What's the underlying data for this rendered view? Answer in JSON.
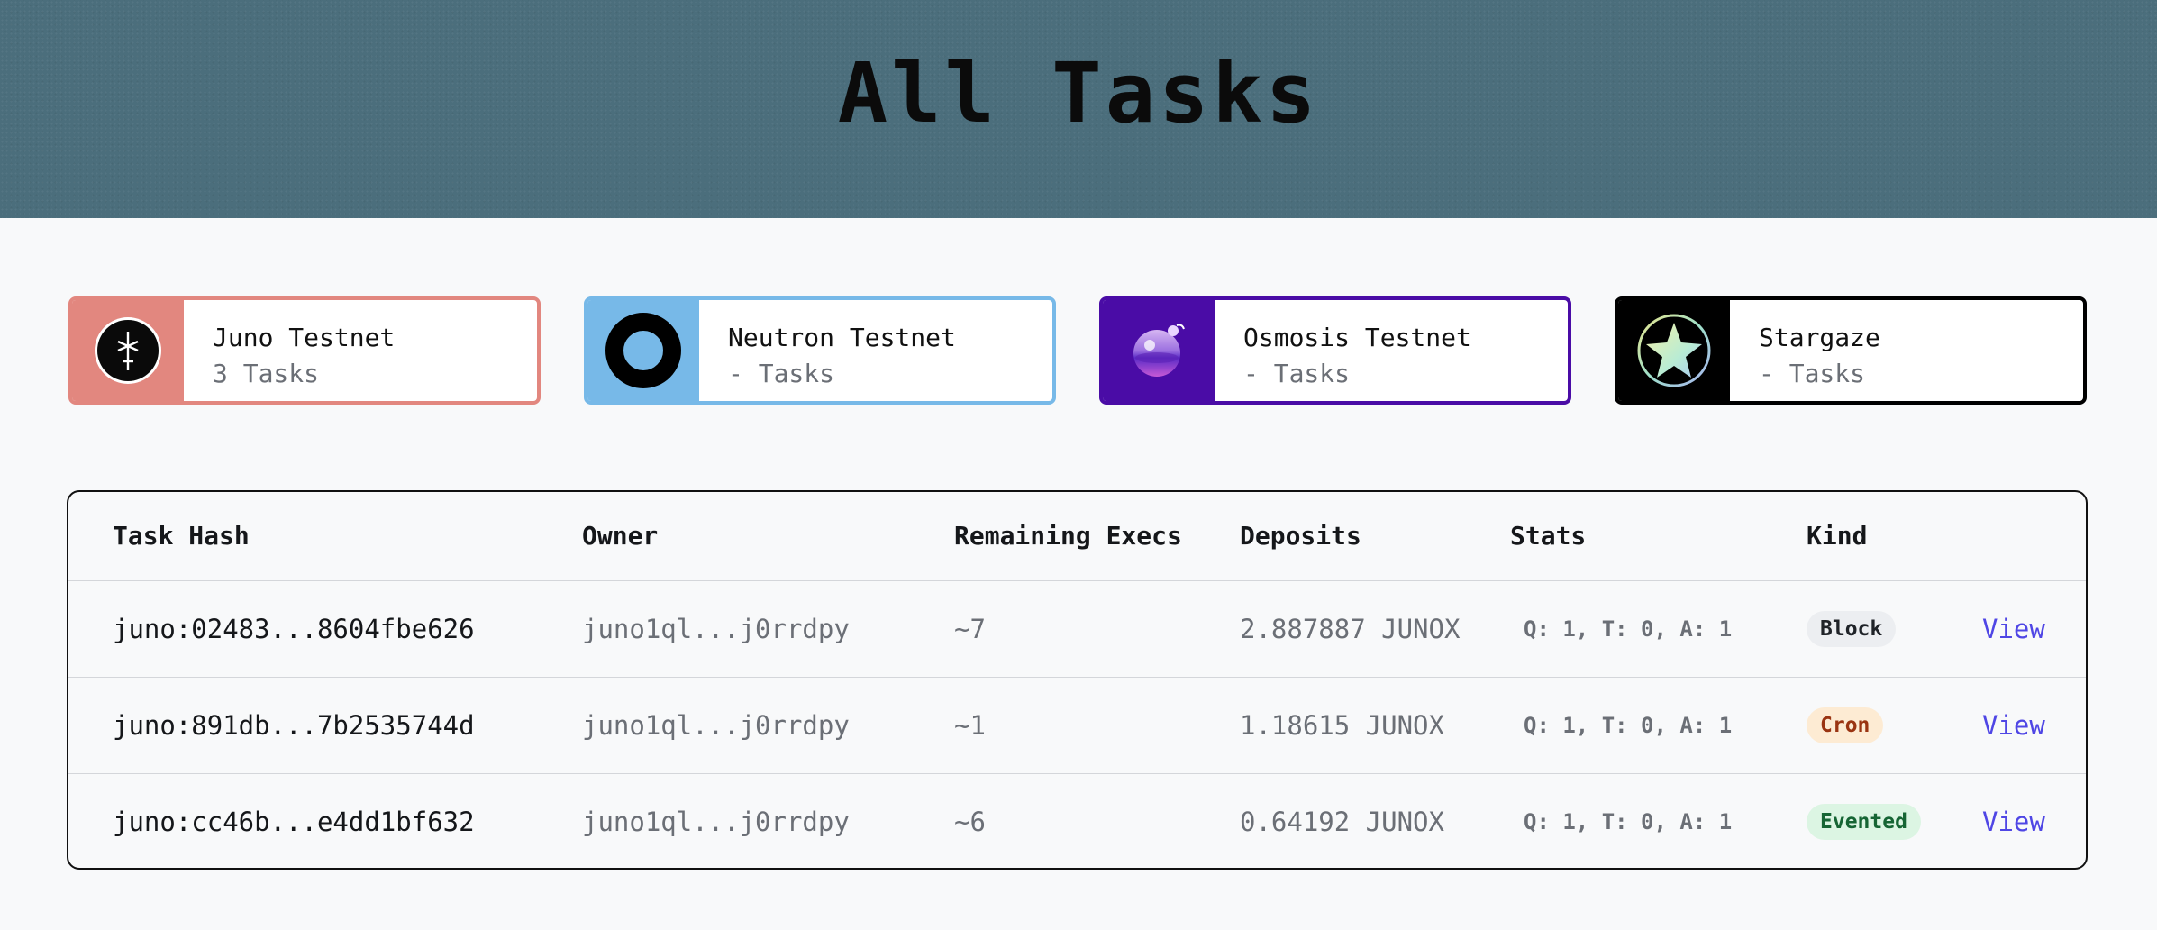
{
  "page": {
    "title": "All Tasks"
  },
  "chains": [
    {
      "name": "Juno Testnet",
      "count": "3 Tasks",
      "color": "#e2877f",
      "icon": "juno-logo-icon"
    },
    {
      "name": "Neutron Testnet",
      "count": "- Tasks",
      "color": "#77b9e8",
      "icon": "neutron-logo-icon"
    },
    {
      "name": "Osmosis Testnet",
      "count": "- Tasks",
      "color": "#4a0ca6",
      "icon": "osmosis-logo-icon"
    },
    {
      "name": "Stargaze",
      "count": "- Tasks",
      "color": "#000000",
      "icon": "stargaze-logo-icon"
    }
  ],
  "table": {
    "headers": {
      "hash": "Task Hash",
      "owner": "Owner",
      "remaining": "Remaining Execs",
      "deposits": "Deposits",
      "stats": "Stats",
      "kind": "Kind"
    },
    "rows": [
      {
        "hash": "juno:02483...8604fbe626",
        "owner": "juno1ql...j0rrdpy",
        "remaining": "~7",
        "deposits": "2.887887 JUNOX",
        "stats": "Q: 1, T: 0, A: 1",
        "kind": "Block",
        "kind_bg": "#eceef1",
        "kind_fg": "#1f2328",
        "view": "View"
      },
      {
        "hash": "juno:891db...7b2535744d",
        "owner": "juno1ql...j0rrdpy",
        "remaining": "~1",
        "deposits": "1.18615 JUNOX",
        "stats": "Q: 1, T: 0, A: 1",
        "kind": "Cron",
        "kind_bg": "#fdebd3",
        "kind_fg": "#9a3412",
        "view": "View"
      },
      {
        "hash": "juno:cc46b...e4dd1bf632",
        "owner": "juno1ql...j0rrdpy",
        "remaining": "~6",
        "deposits": "0.64192 JUNOX",
        "stats": "Q: 1, T: 0, A: 1",
        "kind": "Evented",
        "kind_bg": "#dcf5e3",
        "kind_fg": "#166534",
        "view": "View"
      }
    ]
  },
  "colors": {
    "accent": "#4f46e5",
    "banner": "#4b6e7c"
  }
}
